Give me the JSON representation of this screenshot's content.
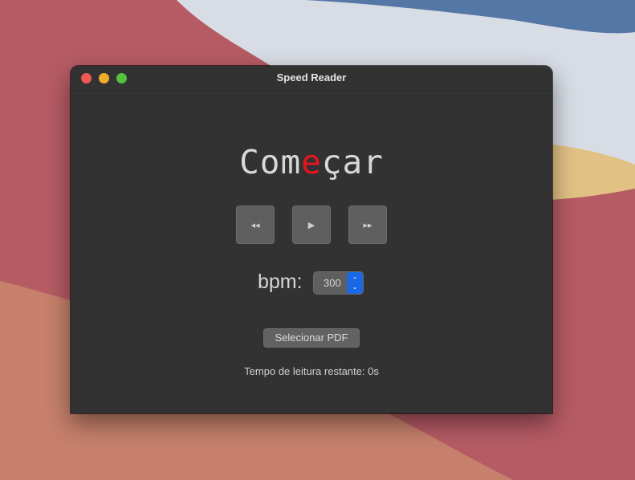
{
  "window": {
    "title": "Speed Reader"
  },
  "reader": {
    "word_before": "Com",
    "word_focus": "e",
    "word_after": "çar"
  },
  "controls": {
    "rewind_icon": "◂◂",
    "play_icon": "▶",
    "forward_icon": "▸▸"
  },
  "bpm": {
    "label": "bpm:",
    "value": "300"
  },
  "actions": {
    "select_pdf_label": "Selecionar PDF"
  },
  "status": {
    "remaining_text": "Tempo de leitura restante: 0s"
  },
  "colors": {
    "focus_letter": "#e8141e",
    "accent": "#1a68e5"
  }
}
